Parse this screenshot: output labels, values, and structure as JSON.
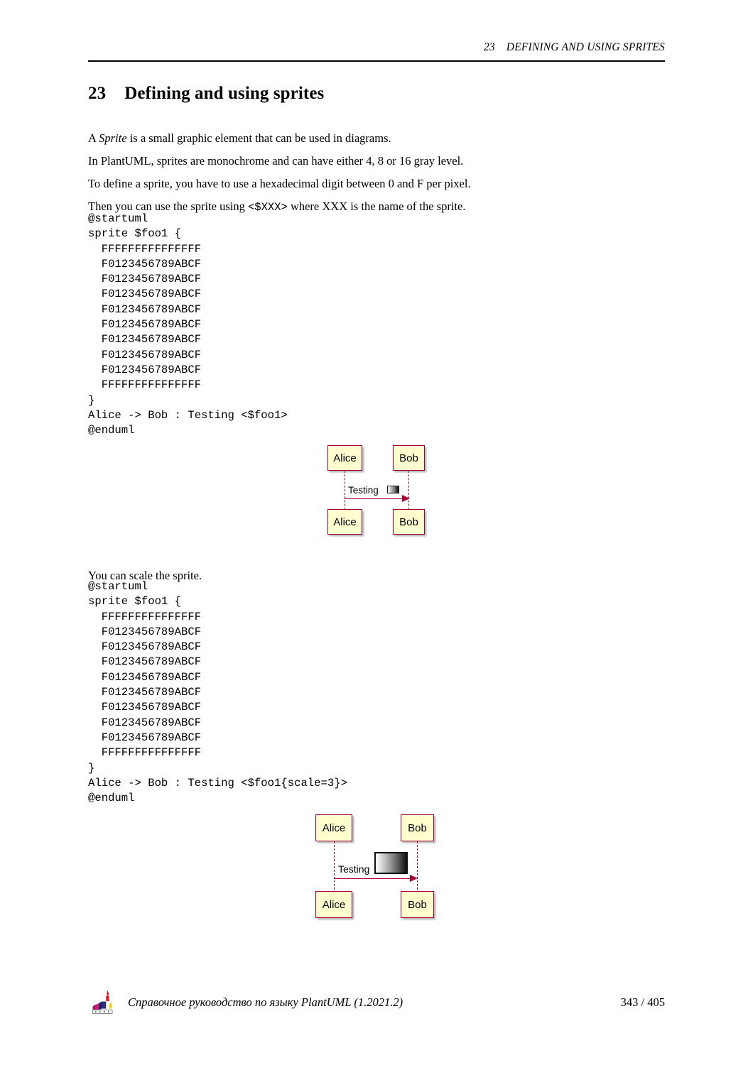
{
  "header": {
    "section_number": "23",
    "title": "DEFINING AND USING SPRITES"
  },
  "section": {
    "number": "23",
    "heading": "Defining and using sprites"
  },
  "paragraphs": {
    "p1_a": "A ",
    "p1_em": "Sprite",
    "p1_b": " is a small graphic element that can be used in diagrams.",
    "p2": "In PlantUML, sprites are monochrome and can have either 4, 8 or 16 gray level.",
    "p3": "To define a sprite, you have to use a hexadecimal digit between 0 and F per pixel.",
    "p4_a": "Then you can use the sprite using ",
    "p4_code": "<$XXX>",
    "p4_b": " where XXX is the name of the sprite.",
    "p5": "You can scale the sprite."
  },
  "code_block_1": "@startuml\nsprite $foo1 {\n  FFFFFFFFFFFFFFF\n  F0123456789ABCF\n  F0123456789ABCF\n  F0123456789ABCF\n  F0123456789ABCF\n  F0123456789ABCF\n  F0123456789ABCF\n  F0123456789ABCF\n  F0123456789ABCF\n  FFFFFFFFFFFFFFF\n}\nAlice -> Bob : Testing <$foo1>\n@enduml",
  "code_block_2": "@startuml\nsprite $foo1 {\n  FFFFFFFFFFFFFFF\n  F0123456789ABCF\n  F0123456789ABCF\n  F0123456789ABCF\n  F0123456789ABCF\n  F0123456789ABCF\n  F0123456789ABCF\n  F0123456789ABCF\n  F0123456789ABCF\n  FFFFFFFFFFFFFFF\n}\nAlice -> Bob : Testing <$foo1{scale=3}>\n@enduml",
  "diagram_1": {
    "participant_a_top": "Alice",
    "participant_b_top": "Bob",
    "participant_a_bottom": "Alice",
    "participant_b_bottom": "Bob",
    "message_label": "Testing",
    "sprite_name": "foo1-sprite"
  },
  "diagram_2": {
    "participant_a_top": "Alice",
    "participant_b_top": "Bob",
    "participant_a_bottom": "Alice",
    "participant_b_bottom": "Bob",
    "message_label": "Testing",
    "sprite_name": "foo1-sprite-scale-3"
  },
  "footer": {
    "logo": "plantuml-logo-icon",
    "text": "Справочное руководство по языку PlantUML (1.2021.2)",
    "page": "343 / 405"
  },
  "colors": {
    "box_fill": "#FEFECE",
    "box_border": "#A80036",
    "line": "#A80036",
    "text": "#000000",
    "page_bg": "#FFFFFF"
  }
}
